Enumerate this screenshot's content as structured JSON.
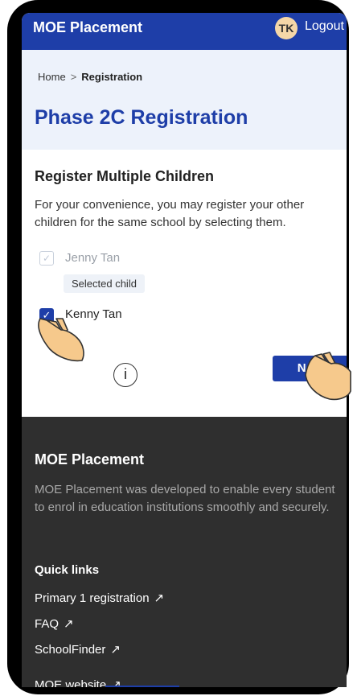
{
  "appbar": {
    "title": "MOE Placement",
    "avatar_initials": "TK",
    "logout_label": "Logout"
  },
  "breadcrumb": {
    "home": "Home",
    "separator": ">",
    "current": "Registration"
  },
  "page_title": "Phase 2C Registration",
  "section": {
    "title": "Register Multiple Children",
    "description": "For your convenience, you may register your other children for the same school by selecting them."
  },
  "children": [
    {
      "name": "Jenny Tan",
      "checked": true,
      "disabled": true,
      "badge": "Selected child"
    },
    {
      "name": "Kenny Tan",
      "checked": true,
      "disabled": false
    }
  ],
  "next_label": "Next",
  "info_marker": "i",
  "footer": {
    "title": "MOE Placement",
    "description": "MOE Placement was developed to enable every student to enrol in education institutions smoothly and securely.",
    "quick_links_title": "Quick links",
    "links": [
      "Primary 1 registration",
      "FAQ",
      "SchoolFinder",
      "MOE website"
    ],
    "link_arrow": "↗"
  },
  "colors": {
    "brand": "#1e3ea8",
    "hero_bg": "#edf2fb",
    "footer_bg": "#2f2f2f",
    "hand": "#f6c98c"
  },
  "icons": {
    "check": "check-icon",
    "external_link": "external-link-icon",
    "pointer": "hand-pointer-icon"
  }
}
